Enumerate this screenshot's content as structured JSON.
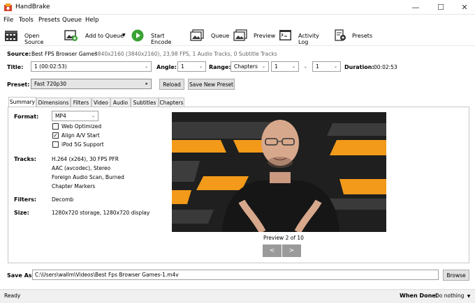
{
  "window": {
    "title": "HandBrake",
    "controls": {
      "minimize": "—",
      "maximize": "☐",
      "close": "✕"
    }
  },
  "menu": [
    "File",
    "Tools",
    "Presets",
    "Queue",
    "Help"
  ],
  "toolbar": {
    "open_source": "Open Source",
    "add_to_queue": "Add to Queue",
    "start_encode": "Start Encode",
    "queue": "Queue",
    "preview": "Preview",
    "activity_log": "Activity Log",
    "presets": "Presets"
  },
  "source": {
    "label": "Source:",
    "name": "Best FPS Browser Games",
    "details": "3840x2160 (3840x2160), 23,98 FPS, 1 Audio Tracks, 0 Subtitle Tracks"
  },
  "title_row": {
    "title_label": "Title:",
    "title_value": "1  (00:02:53)",
    "angle_label": "Angle:",
    "angle_value": "1",
    "range_label": "Range:",
    "range_value": "Chapters",
    "range_start": "1",
    "range_sep": "-",
    "range_end": "1",
    "duration_label": "Duration:",
    "duration_value": "00:02:53"
  },
  "preset_row": {
    "label": "Preset:",
    "value": "Fast 720p30",
    "reload": "Reload",
    "save_new": "Save New Preset"
  },
  "tabs": [
    "Summary",
    "Dimensions",
    "Filters",
    "Video",
    "Audio",
    "Subtitles",
    "Chapters"
  ],
  "summary": {
    "format_label": "Format:",
    "format_value": "MP4",
    "web_optimized": "Web Optimized",
    "web_optimized_checked": false,
    "align_av": "Align A/V Start",
    "align_av_checked": true,
    "ipod": "iPod 5G Support",
    "ipod_checked": false,
    "tracks_label": "Tracks:",
    "tracks": [
      "H.264 (x264), 30 FPS PFR",
      "AAC (avcodec), Stereo",
      "Foreign Audio Scan, Burned",
      "Chapter Markers"
    ],
    "filters_label": "Filters:",
    "filters_value": "Decomb",
    "size_label": "Size:",
    "size_value": "1280x720 storage, 1280x720 display"
  },
  "preview": {
    "caption": "Preview 2 of 10",
    "prev": "<",
    "next": ">"
  },
  "save_as": {
    "label": "Save As:",
    "path": "C:\\Users\\wallm\\Videos\\Best Fps Browser Games-1.m4v",
    "browse": "Browse"
  },
  "status": {
    "text": "Ready",
    "when_done_label": "When Done:",
    "when_done_value": "Do nothing"
  },
  "colors": {
    "accent_green": "#3aa335",
    "orange": "#f39a1a"
  }
}
